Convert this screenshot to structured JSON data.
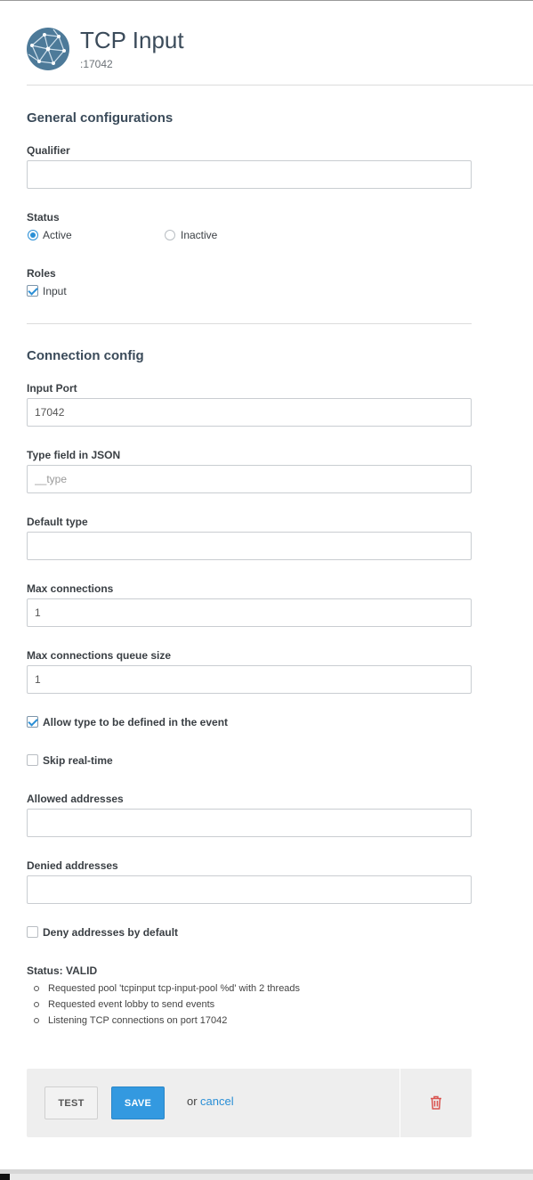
{
  "header": {
    "title": "TCP Input",
    "subtitle": ":17042",
    "icon": "network-globe-icon"
  },
  "general": {
    "section_title": "General configurations",
    "qualifier": {
      "label": "Qualifier",
      "value": ""
    },
    "status": {
      "label": "Status",
      "options": [
        {
          "label": "Active",
          "selected": true
        },
        {
          "label": "Inactive",
          "selected": false
        }
      ]
    },
    "roles": {
      "label": "Roles",
      "options": [
        {
          "label": "Input",
          "checked": true
        }
      ]
    }
  },
  "connection": {
    "section_title": "Connection config",
    "input_port": {
      "label": "Input Port",
      "value": "17042"
    },
    "type_field": {
      "label": "Type field in JSON",
      "placeholder": "__type"
    },
    "default_type": {
      "label": "Default type",
      "value": ""
    },
    "max_connections": {
      "label": "Max connections",
      "value": "1"
    },
    "max_queue": {
      "label": "Max connections queue size",
      "value": "1"
    },
    "allow_type": {
      "label": "Allow type to be defined in the event",
      "checked": true
    },
    "skip_realtime": {
      "label": "Skip real-time",
      "checked": false
    },
    "allowed_addresses": {
      "label": "Allowed addresses",
      "value": ""
    },
    "denied_addresses": {
      "label": "Denied addresses",
      "value": ""
    },
    "deny_default": {
      "label": "Deny addresses by default",
      "checked": false
    }
  },
  "status_block": {
    "title": "Status: VALID",
    "messages": [
      "Requested pool 'tcpinput tcp-input-pool %d' with 2 threads",
      "Requested event lobby to send events",
      "Listening TCP connections on port 17042"
    ]
  },
  "actions": {
    "test_label": "TEST",
    "save_label": "SAVE",
    "or_text": "or",
    "cancel_label": "cancel",
    "delete_icon": "trash-icon"
  },
  "colors": {
    "accent": "#2a8fd6",
    "save_button": "#3399e0",
    "delete": "#d9534f",
    "title": "#3b4b5a"
  }
}
